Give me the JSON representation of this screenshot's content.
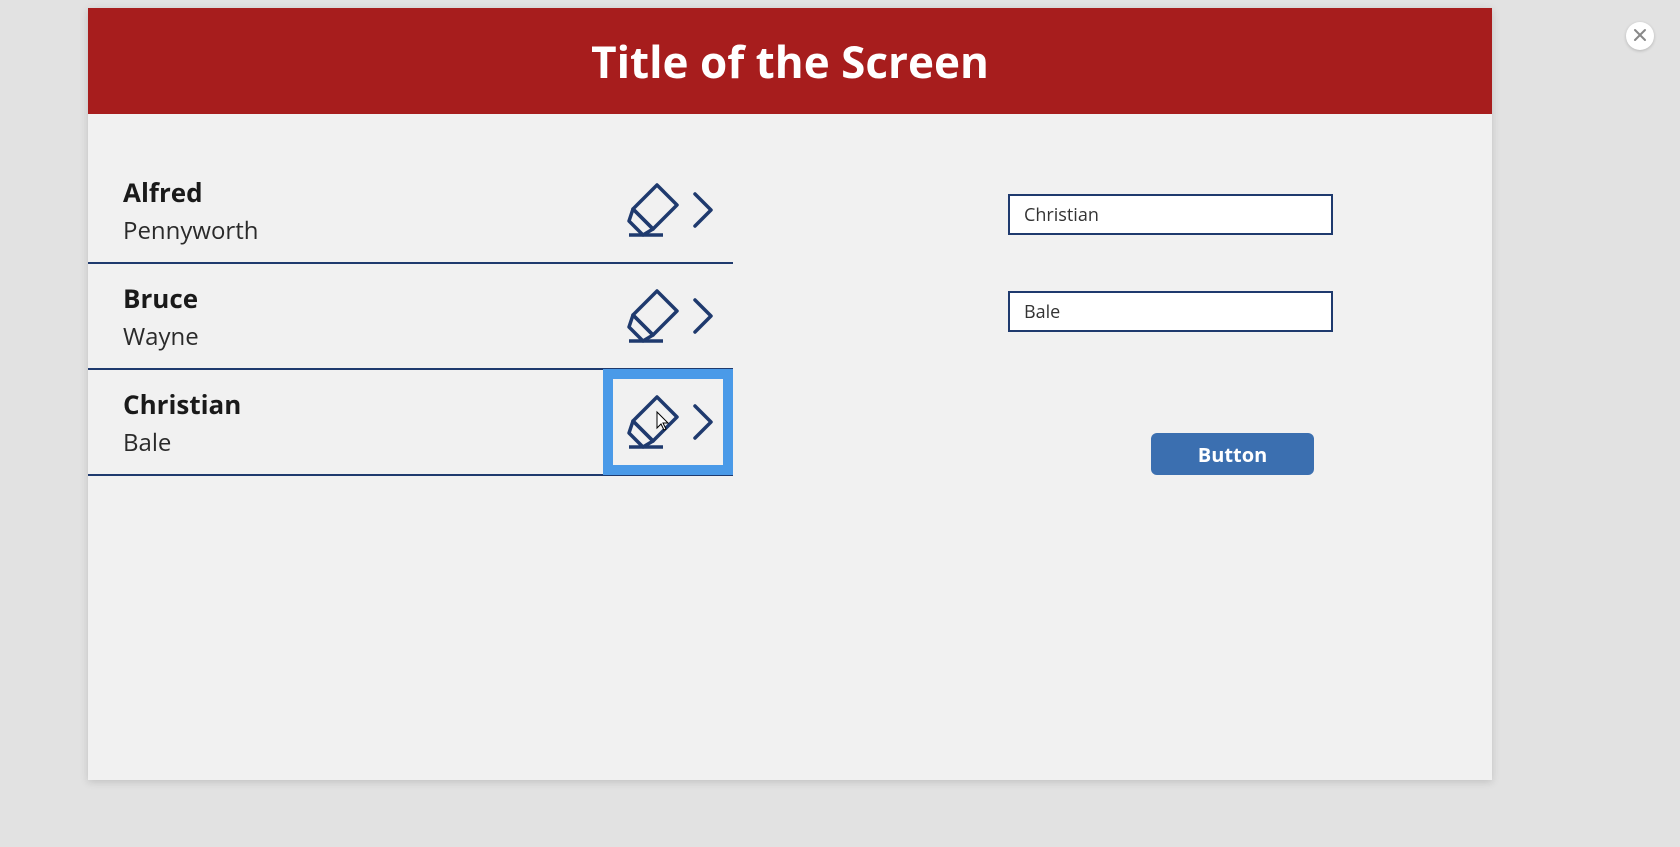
{
  "header": {
    "title": "Title of the Screen"
  },
  "list": {
    "items": [
      {
        "first": "Alfred",
        "last": "Pennyworth",
        "selected": false
      },
      {
        "first": "Bruce",
        "last": "Wayne",
        "selected": false
      },
      {
        "first": "Christian",
        "last": "Bale",
        "selected": true
      }
    ]
  },
  "form": {
    "first_name": "Christian",
    "last_name": "Bale",
    "button_label": "Button"
  },
  "colors": {
    "header_bg": "#a71d1d",
    "accent": "#1f3a6e",
    "highlight": "#4a9ae8",
    "button": "#3b6fb0"
  }
}
